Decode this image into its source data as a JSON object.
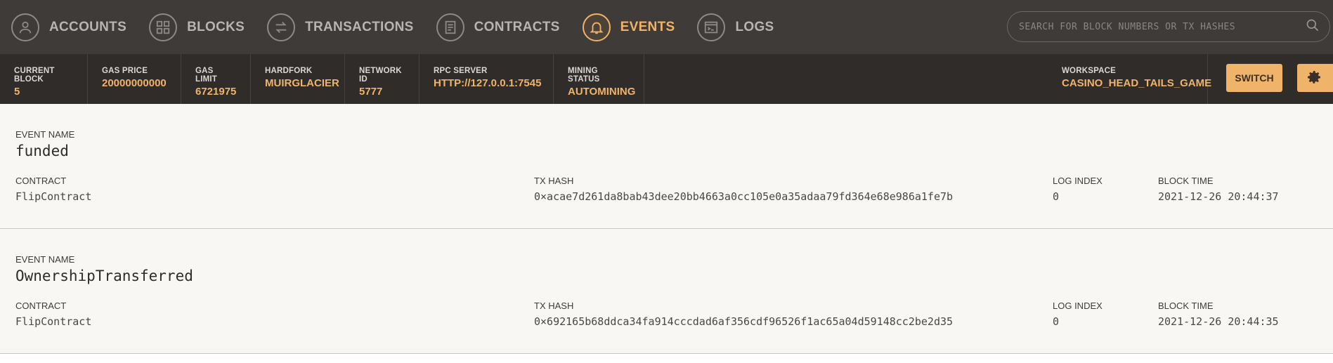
{
  "nav": {
    "items": [
      {
        "label": "ACCOUNTS",
        "icon": "account-icon",
        "active": false
      },
      {
        "label": "BLOCKS",
        "icon": "blocks-icon",
        "active": false
      },
      {
        "label": "TRANSACTIONS",
        "icon": "transactions-icon",
        "active": false
      },
      {
        "label": "CONTRACTS",
        "icon": "contracts-icon",
        "active": false
      },
      {
        "label": "EVENTS",
        "icon": "bell-icon",
        "active": true
      },
      {
        "label": "LOGS",
        "icon": "terminal-icon",
        "active": false
      }
    ],
    "search_placeholder": "SEARCH FOR BLOCK NUMBERS OR TX HASHES"
  },
  "status": {
    "current_block": {
      "label": "CURRENT BLOCK",
      "value": "5"
    },
    "gas_price": {
      "label": "GAS PRICE",
      "value": "20000000000"
    },
    "gas_limit": {
      "label": "GAS LIMIT",
      "value": "6721975"
    },
    "hardfork": {
      "label": "HARDFORK",
      "value": "MUIRGLACIER"
    },
    "network_id": {
      "label": "NETWORK ID",
      "value": "5777"
    },
    "rpc_server": {
      "label": "RPC SERVER",
      "value": "HTTP://127.0.0.1:7545"
    },
    "mining_status": {
      "label": "MINING STATUS",
      "value": "AUTOMINING"
    },
    "workspace": {
      "label": "WORKSPACE",
      "value": "CASINO_HEAD_TAILS_GAME"
    },
    "switch_label": "SWITCH"
  },
  "labels": {
    "event_name": "EVENT NAME",
    "contract": "CONTRACT",
    "tx_hash": "TX HASH",
    "log_index": "LOG INDEX",
    "block_time": "BLOCK TIME"
  },
  "events": [
    {
      "name": "funded",
      "contract": "FlipContract",
      "tx_hash": "0×acae7d261da8bab43dee20bb4663a0cc105e0a35adaa79fd364e68e986a1fe7b",
      "log_index": "0",
      "block_time": "2021-12-26 20:44:37"
    },
    {
      "name": "OwnershipTransferred",
      "contract": "FlipContract",
      "tx_hash": "0×692165b68ddca34fa914cccdad6af356cdf96526f1ac65a04d59148cc2be2d35",
      "log_index": "0",
      "block_time": "2021-12-26 20:44:35"
    }
  ],
  "colors": {
    "accent": "#f0b36a",
    "topbar": "#3e3b38",
    "statusbar": "#2f2c2a"
  }
}
